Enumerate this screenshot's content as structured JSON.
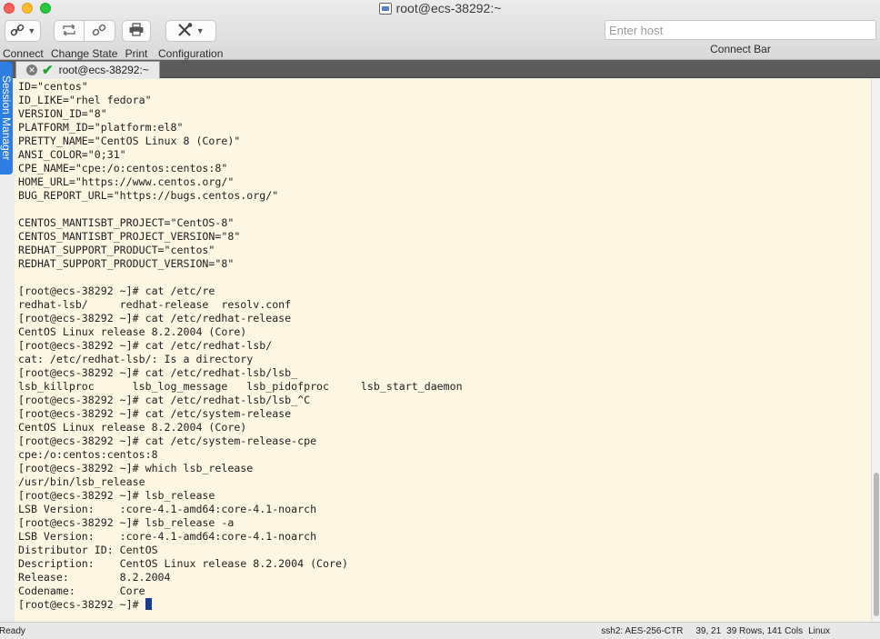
{
  "window": {
    "title": "root@ecs-38292:~"
  },
  "toolbar": {
    "connect_label": "Connect",
    "change_state_label": "Change State",
    "print_label": "Print",
    "configuration_label": "Configuration"
  },
  "connect_bar": {
    "placeholder": "Enter host",
    "label": "Connect Bar"
  },
  "tabs": [
    {
      "label": "root@ecs-38292:~",
      "status": "connected"
    }
  ],
  "session_manager": {
    "label": "Session Manager"
  },
  "terminal": {
    "lines": [
      "ID=\"centos\"",
      "ID_LIKE=\"rhel fedora\"",
      "VERSION_ID=\"8\"",
      "PLATFORM_ID=\"platform:el8\"",
      "PRETTY_NAME=\"CentOS Linux 8 (Core)\"",
      "ANSI_COLOR=\"0;31\"",
      "CPE_NAME=\"cpe:/o:centos:centos:8\"",
      "HOME_URL=\"https://www.centos.org/\"",
      "BUG_REPORT_URL=\"https://bugs.centos.org/\"",
      "",
      "CENTOS_MANTISBT_PROJECT=\"CentOS-8\"",
      "CENTOS_MANTISBT_PROJECT_VERSION=\"8\"",
      "REDHAT_SUPPORT_PRODUCT=\"centos\"",
      "REDHAT_SUPPORT_PRODUCT_VERSION=\"8\"",
      "",
      "[root@ecs-38292 ~]# cat /etc/re",
      "redhat-lsb/     redhat-release  resolv.conf",
      "[root@ecs-38292 ~]# cat /etc/redhat-release",
      "CentOS Linux release 8.2.2004 (Core)",
      "[root@ecs-38292 ~]# cat /etc/redhat-lsb/",
      "cat: /etc/redhat-lsb/: Is a directory",
      "[root@ecs-38292 ~]# cat /etc/redhat-lsb/lsb_",
      "lsb_killproc      lsb_log_message   lsb_pidofproc     lsb_start_daemon",
      "[root@ecs-38292 ~]# cat /etc/redhat-lsb/lsb_^C",
      "[root@ecs-38292 ~]# cat /etc/system-release",
      "CentOS Linux release 8.2.2004 (Core)",
      "[root@ecs-38292 ~]# cat /etc/system-release-cpe",
      "cpe:/o:centos:centos:8",
      "[root@ecs-38292 ~]# which lsb_release",
      "/usr/bin/lsb_release",
      "[root@ecs-38292 ~]# lsb_release",
      "LSB Version:    :core-4.1-amd64:core-4.1-noarch",
      "[root@ecs-38292 ~]# lsb_release -a",
      "LSB Version:    :core-4.1-amd64:core-4.1-noarch",
      "Distributor ID: CentOS",
      "Description:    CentOS Linux release 8.2.2004 (Core)",
      "Release:        8.2.2004",
      "Codename:       Core"
    ],
    "prompt": "[root@ecs-38292 ~]# "
  },
  "statusbar": {
    "state": "Ready",
    "encryption": "ssh2: AES-256-CTR",
    "cursor_pos": "39, 21",
    "size": "39 Rows, 141 Cols",
    "emulation": "Linux"
  },
  "colors": {
    "terminal_bg": "#fdf6e3",
    "session_manager_bg": "#2d7ee3",
    "tab_strip_bg": "#5b5b5b",
    "connected_check": "#21a52b"
  }
}
